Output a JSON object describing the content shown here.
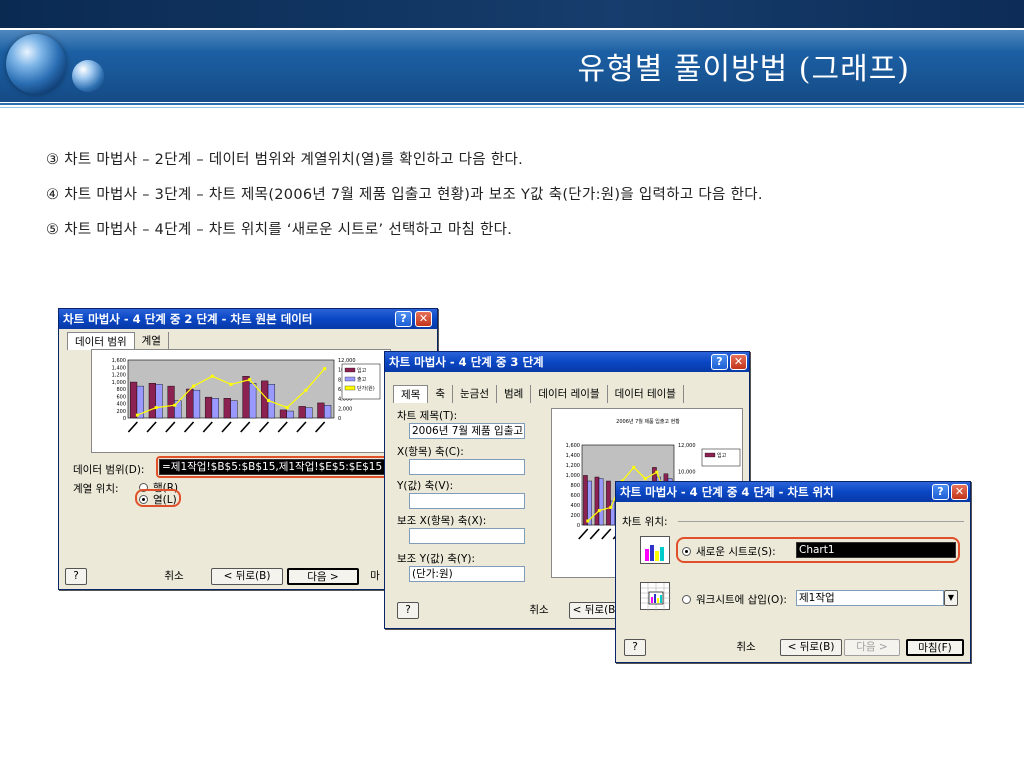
{
  "slide": {
    "title": "유형별 풀이방법 (그래프)",
    "steps": [
      "③ 차트 마법사 – 2단계 – 데이터 범위와 계열위치(열)를 확인하고 다음 한다.",
      "④ 차트 마법사 – 3단계 – 차트 제목(2006년 7월 제품 입출고 현황)과 보조 Y값 축(단가:원)을 입력하고 다음 한다.",
      "⑤ 차트 마법사 – 4단계 –  차트 위치를 ‘새로운 시트로’ 선택하고 마침 한다."
    ]
  },
  "dialog2": {
    "title": "차트 마법사 - 4 단계 중 2 단계 - 차트 원본 데이터",
    "tabs": [
      "데이터 범위",
      "계열"
    ],
    "data_range_label": "데이터 범위(D):",
    "data_range_value": "=제1작업!$B$5:$B$15,제1작업!$E$5:$E$15",
    "series_in_label": "계열 위치:",
    "row_option": "행(R)",
    "column_option": "열(L)",
    "buttons": {
      "help": "?",
      "cancel": "취소",
      "back": "< 뒤로(B)",
      "next": "다음 >",
      "finish": "마"
    },
    "y_ticks": [
      "1,600",
      "1,400",
      "1,200",
      "1,000",
      "800",
      "600",
      "400",
      "200",
      "0"
    ],
    "y2_ticks": [
      "12,000",
      "10,000",
      "8,000",
      "6,000",
      "4,000",
      "2,000",
      "0"
    ],
    "legend": [
      "입고",
      "출고",
      "단가(원)"
    ]
  },
  "dialog3": {
    "title": "차트 마법사 - 4 단계 중 3 단계",
    "tabs": [
      "제목",
      "축",
      "눈금선",
      "범례",
      "데이터 레이블",
      "데이터 테이블"
    ],
    "chart_title_label": "차트 제목(T):",
    "chart_title_value": "2006년 7월 제품 입출고 현",
    "x_axis_label": "X(항목) 축(C):",
    "y_axis_label": "Y(값) 축(V):",
    "x2_axis_label": "보조 X(항목) 축(X):",
    "y2_axis_label": "보조 Y(값) 축(Y):",
    "y2_axis_value": "(단가:원)",
    "preview_title": "2006년 7월 제품 입출고 현황",
    "y_ticks": [
      "1,600",
      "1,400",
      "1,200",
      "1,000",
      "800",
      "600",
      "400",
      "200",
      "0"
    ],
    "y2_ticks": [
      "12,000",
      "10,000",
      "8,000",
      "6,000"
    ],
    "legend": [
      "입고"
    ],
    "buttons": {
      "help": "?",
      "cancel": "취소",
      "back": "< 뒤로(B"
    }
  },
  "dialog4": {
    "title": "차트 마법사 - 4 단계 중 4 단계 - 차트 위치",
    "group_label": "차트 위치:",
    "new_sheet_label": "새로운 시트로(S):",
    "new_sheet_value": "Chart1",
    "as_object_label": "워크시트에 삽입(O):",
    "as_object_value": "제1작업",
    "buttons": {
      "help": "?",
      "cancel": "취소",
      "back": "< 뒤로(B)",
      "next": "다음 >",
      "finish": "마침(F)"
    }
  },
  "colors": {
    "bar_in": "#8b2252",
    "bar_out": "#9999ff",
    "line": "#ffff00",
    "titlebar": "#0a47c4",
    "highlight": "#e0502a"
  }
}
